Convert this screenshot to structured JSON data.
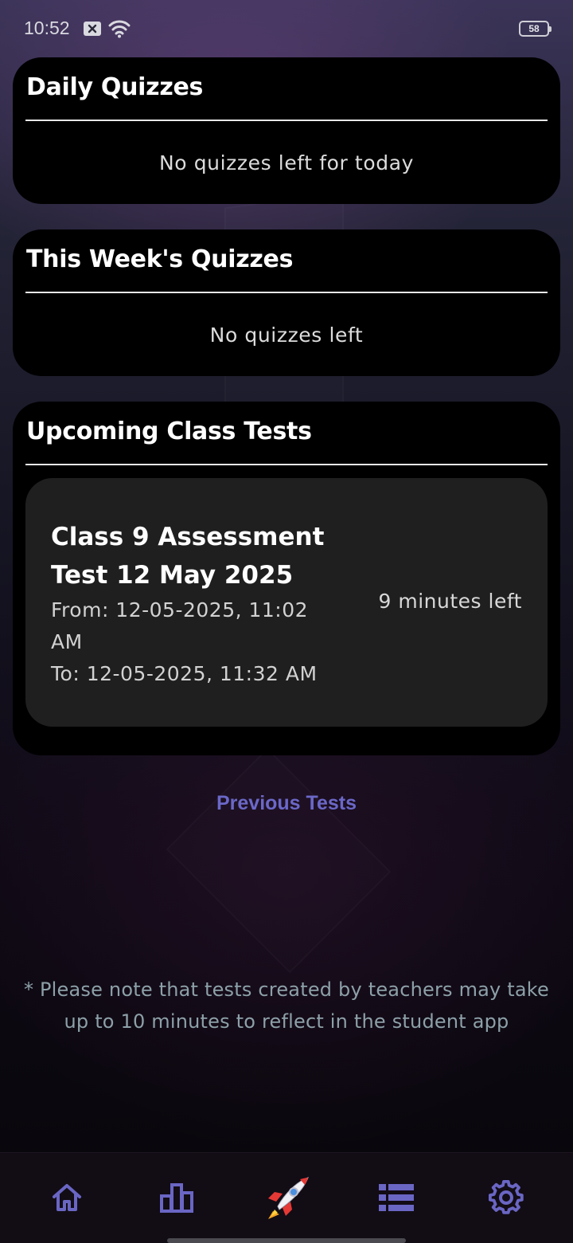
{
  "status_bar": {
    "time": "10:52",
    "battery": "58",
    "icons": [
      "notification-x-icon",
      "wifi-icon",
      "battery-icon"
    ]
  },
  "daily": {
    "title": "Daily Quizzes",
    "empty": "No quizzes left for today"
  },
  "weekly": {
    "title": "This Week's Quizzes",
    "empty": "No quizzes left"
  },
  "upcoming": {
    "title": "Upcoming Class Tests",
    "tests": [
      {
        "name": "Class 9 Assessment Test 12 May 2025",
        "from_line1": "From: 12-05-2025, 11:02",
        "from_line2": "AM",
        "to": "To: 12-05-2025, 11:32 AM",
        "remaining": "9 minutes left"
      }
    ]
  },
  "previous_tests_label": "Previous Tests",
  "note": "* Please note that tests created by teachers may take up to 10 minutes to reflect in the student app",
  "nav": {
    "items": [
      "home-icon",
      "leaderboard-icon",
      "rocket-icon",
      "list-icon",
      "settings-icon"
    ],
    "active": "rocket-icon"
  },
  "colors": {
    "accent": "#6b68c8",
    "card_bg": "#000000",
    "item_bg": "#1f1f1f",
    "note": "#8da0a8"
  }
}
